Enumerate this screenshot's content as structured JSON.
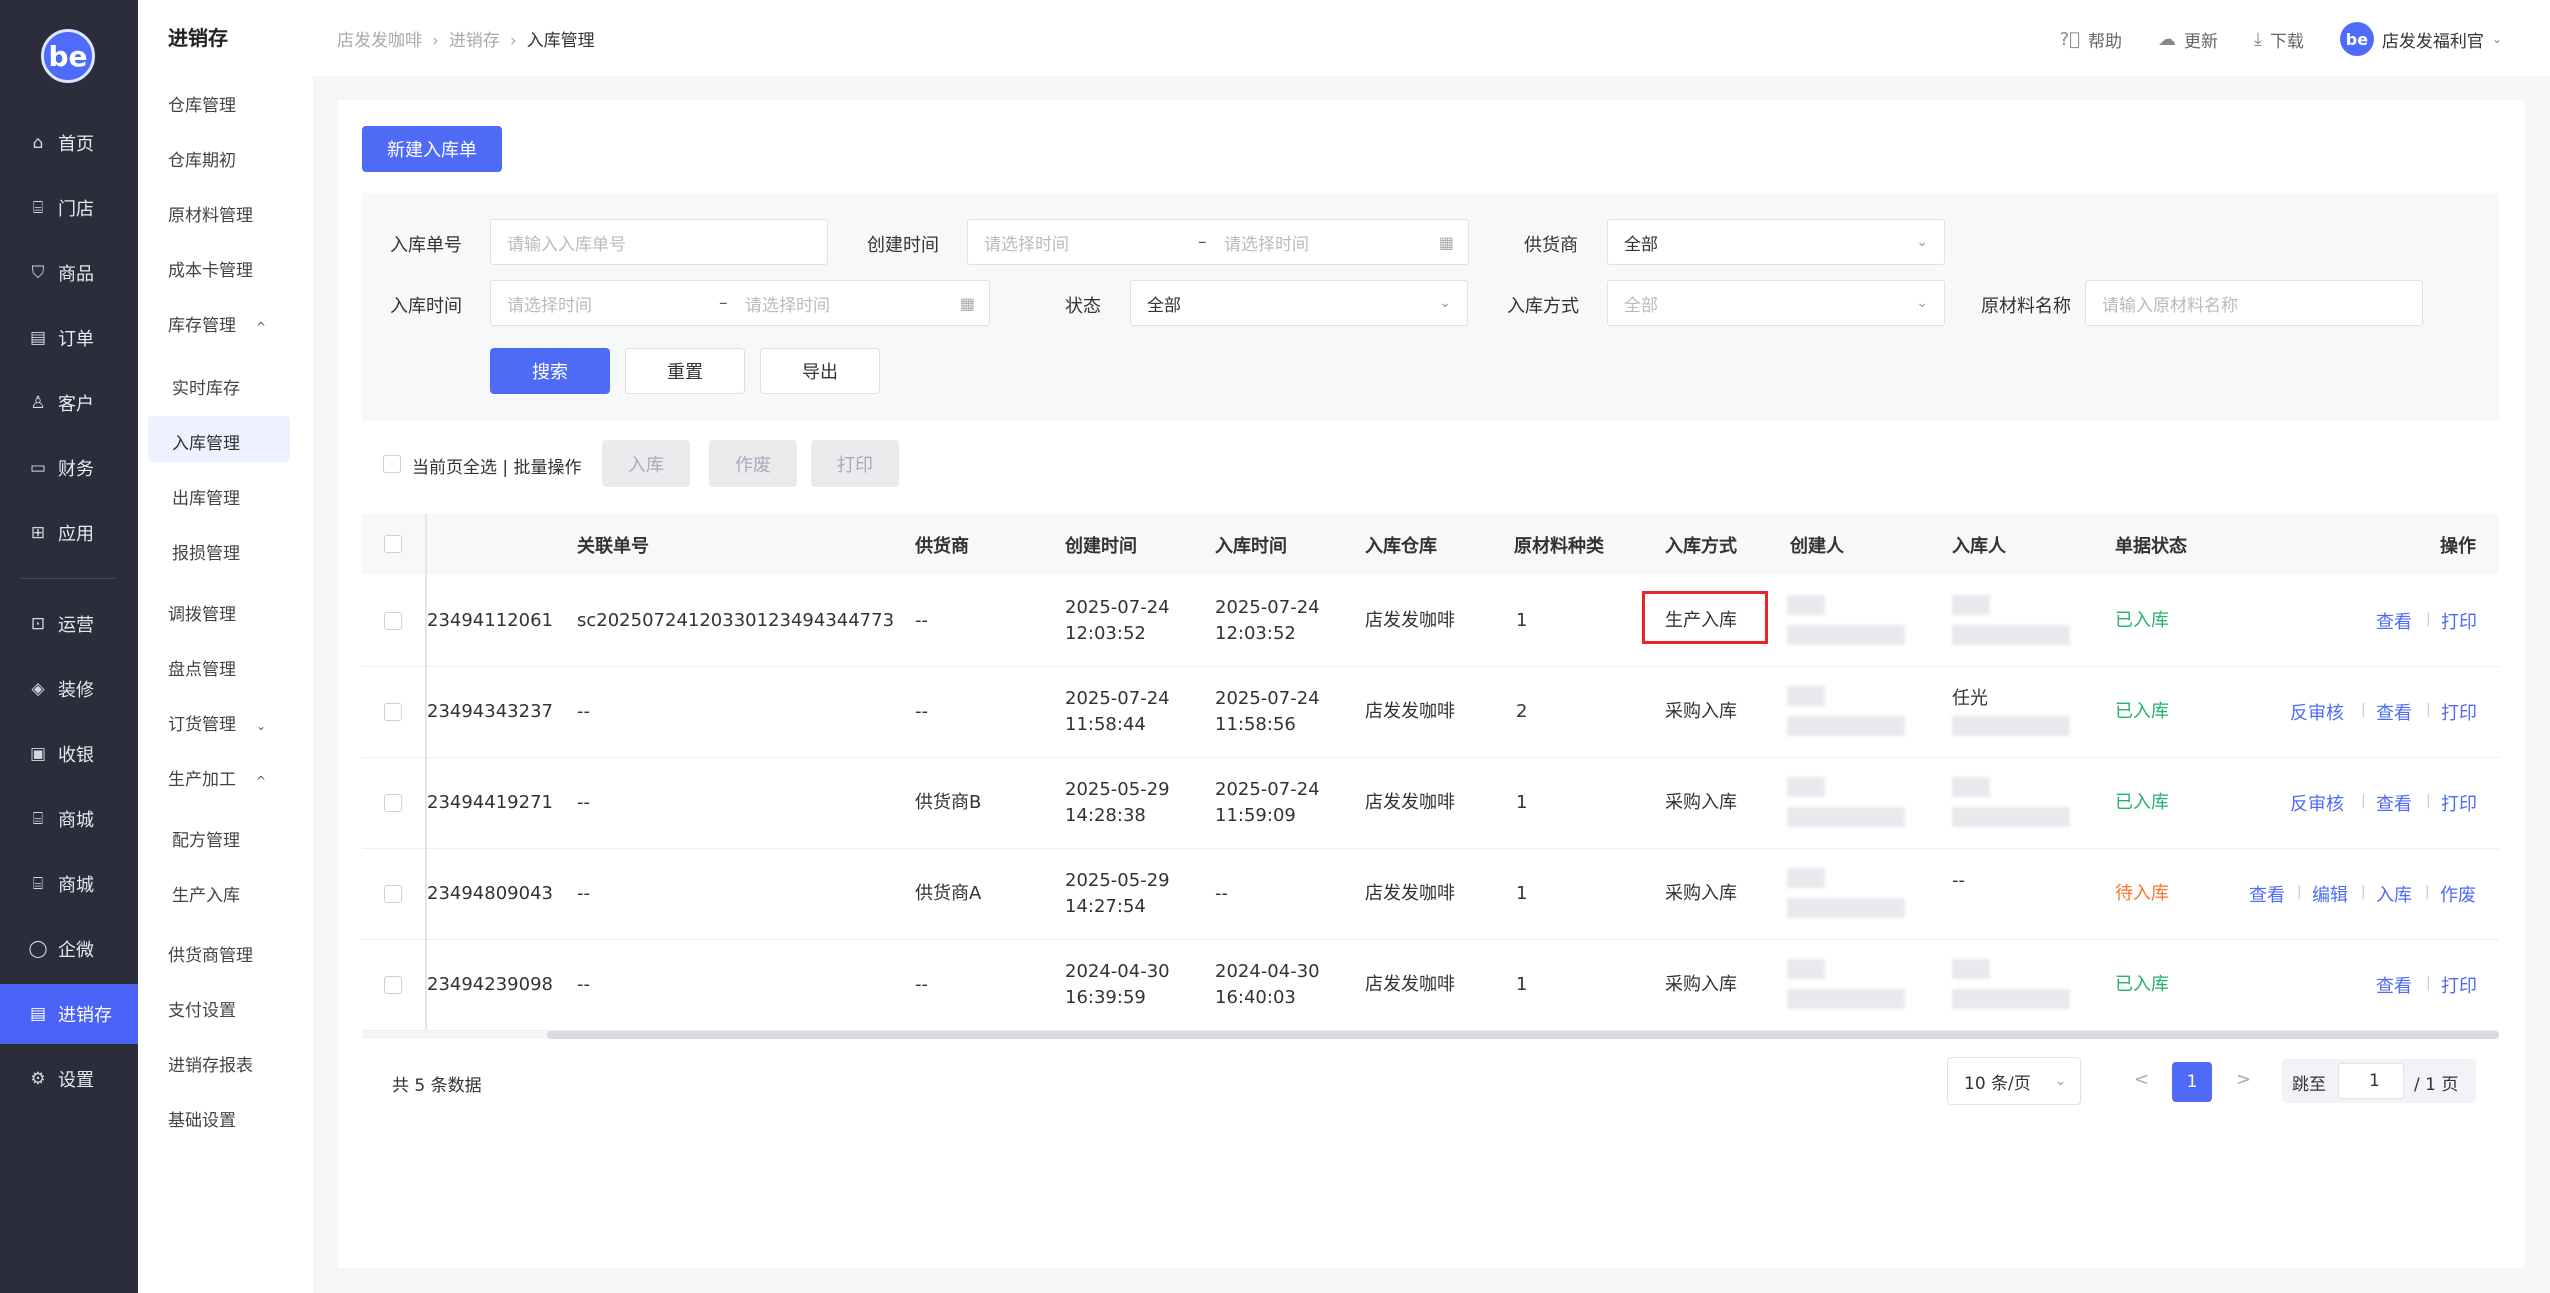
{
  "nav": {
    "logo_text": "be",
    "items": [
      {
        "label": "首页",
        "icon": "⌂"
      },
      {
        "label": "门店",
        "icon": "⌸"
      },
      {
        "label": "商品",
        "icon": "⛉"
      },
      {
        "label": "订单",
        "icon": "▤"
      },
      {
        "label": "客户",
        "icon": "♙"
      },
      {
        "label": "财务",
        "icon": "▭"
      },
      {
        "label": "应用",
        "icon": "⊞"
      },
      {
        "label": "运营",
        "icon": "⊡"
      },
      {
        "label": "装修",
        "icon": "◈"
      },
      {
        "label": "收银",
        "icon": "▣"
      },
      {
        "label": "商城",
        "icon": "⌸"
      },
      {
        "label": "商城",
        "icon": "⌸"
      },
      {
        "label": "企微",
        "icon": "◯"
      },
      {
        "label": "进销存",
        "icon": "▤"
      },
      {
        "label": "设置",
        "icon": "⚙"
      }
    ]
  },
  "submenu": {
    "title": "进销存",
    "items": [
      {
        "label": "仓库管理"
      },
      {
        "label": "仓库期初"
      },
      {
        "label": "原材料管理"
      },
      {
        "label": "成本卡管理"
      },
      {
        "label": "库存管理",
        "arrow": "^"
      },
      {
        "label": "实时库存"
      },
      {
        "label": "入库管理"
      },
      {
        "label": "出库管理"
      },
      {
        "label": "报损管理"
      },
      {
        "label": "调拨管理"
      },
      {
        "label": "盘点管理"
      },
      {
        "label": "订货管理",
        "arrow": "⌄"
      },
      {
        "label": "生产加工",
        "arrow": "^"
      },
      {
        "label": "配方管理"
      },
      {
        "label": "生产入库"
      },
      {
        "label": "供货商管理"
      },
      {
        "label": "支付设置"
      },
      {
        "label": "进销存报表"
      },
      {
        "label": "基础设置"
      }
    ]
  },
  "header": {
    "breadcrumb": [
      "店发发咖啡",
      "进销存",
      "入库管理"
    ],
    "help": "帮助",
    "update": "更新",
    "download": "下载",
    "user": "店发发福利官"
  },
  "toolbar": {
    "new_button": "新建入库单"
  },
  "filters": {
    "order_no_label": "入库单号",
    "order_no_placeholder": "请输入入库单号",
    "create_time_label": "创建时间",
    "time_placeholder": "请选择时间",
    "range_sep": "–",
    "supplier_label": "供货商",
    "supplier_value": "全部",
    "stockin_time_label": "入库时间",
    "status_label": "状态",
    "status_value": "全部",
    "method_label": "入库方式",
    "method_placeholder": "全部",
    "material_label": "原材料名称",
    "material_placeholder": "请输入原材料名称",
    "search": "搜索",
    "reset": "重置",
    "export": "导出"
  },
  "batch": {
    "label": "当前页全选 | 批量操作",
    "stockin": "入库",
    "void": "作废",
    "print": "打印"
  },
  "table": {
    "headers": [
      "关联单号",
      "供货商",
      "创建时间",
      "入库时间",
      "入库仓库",
      "原材料种类",
      "入库方式",
      "创建人",
      "入库人",
      "单据状态",
      "操作"
    ],
    "rows": [
      {
        "no": "23494112061",
        "ref": "sc20250724120330123494344773",
        "supplier": "--",
        "created_date": "2025-07-24",
        "created_time": "12:03:52",
        "in_date": "2025-07-24",
        "in_time": "12:03:52",
        "warehouse": "店发发咖啡",
        "kinds": "1",
        "method": "生产入库",
        "receiver": "",
        "status": "已入库",
        "ops": [
          "查看",
          "打印"
        ]
      },
      {
        "no": "23494343237",
        "ref": "--",
        "supplier": "--",
        "created_date": "2025-07-24",
        "created_time": "11:58:44",
        "in_date": "2025-07-24",
        "in_time": "11:58:56",
        "warehouse": "店发发咖啡",
        "kinds": "2",
        "method": "采购入库",
        "receiver": "任光",
        "status": "已入库",
        "ops": [
          "反审核",
          "查看",
          "打印"
        ]
      },
      {
        "no": "23494419271",
        "ref": "--",
        "supplier": "供货商B",
        "created_date": "2025-05-29",
        "created_time": "14:28:38",
        "in_date": "2025-07-24",
        "in_time": "11:59:09",
        "warehouse": "店发发咖啡",
        "kinds": "1",
        "method": "采购入库",
        "receiver": "",
        "status": "已入库",
        "ops": [
          "反审核",
          "查看",
          "打印"
        ]
      },
      {
        "no": "23494809043",
        "ref": "--",
        "supplier": "供货商A",
        "created_date": "2025-05-29",
        "created_time": "14:27:54",
        "in_date": "--",
        "in_time": "",
        "warehouse": "店发发咖啡",
        "kinds": "1",
        "method": "采购入库",
        "receiver": "--",
        "status": "待入库",
        "ops": [
          "查看",
          "编辑",
          "入库",
          "作废"
        ]
      },
      {
        "no": "23494239098",
        "ref": "--",
        "supplier": "--",
        "created_date": "2024-04-30",
        "created_time": "16:39:59",
        "in_date": "2024-04-30",
        "in_time": "16:40:03",
        "warehouse": "店发发咖啡",
        "kinds": "1",
        "method": "采购入库",
        "receiver": "",
        "status": "已入库",
        "ops": [
          "查看",
          "打印"
        ]
      }
    ]
  },
  "footer": {
    "total": "共 5 条数据",
    "page_size": "10 条/页",
    "prev": "<",
    "next": ">",
    "current_page": "1",
    "jump_label": "跳至",
    "jump_value": "1",
    "total_pages": "/ 1 页"
  },
  "colors": {
    "accent": "#4f6bf6",
    "sidebar": "#2b2d3b",
    "ok": "#21b26b",
    "wait": "#f5762c",
    "highlight": "#e8262a"
  }
}
